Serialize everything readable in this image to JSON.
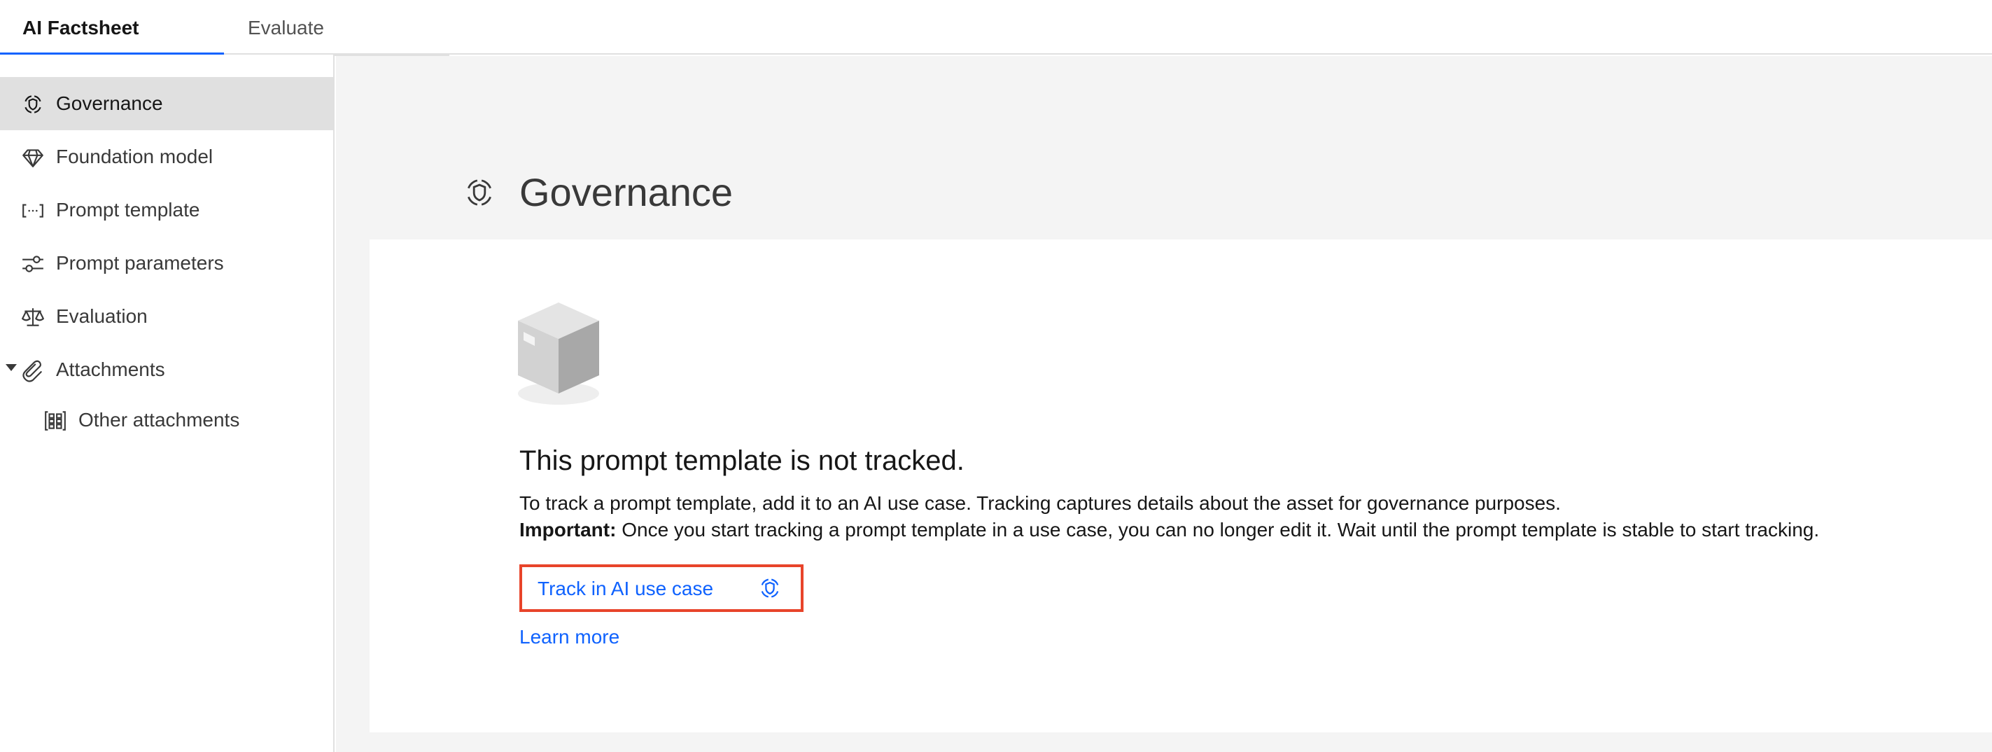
{
  "tabs": [
    {
      "label": "AI Factsheet",
      "selected": true
    },
    {
      "label": "Evaluate",
      "selected": false
    }
  ],
  "sidebar": {
    "items": [
      {
        "label": "Governance",
        "icon": "governance-icon",
        "selected": true
      },
      {
        "label": "Foundation model",
        "icon": "diamond-icon"
      },
      {
        "label": "Prompt template",
        "icon": "brackets-icon"
      },
      {
        "label": "Prompt parameters",
        "icon": "sliders-icon"
      },
      {
        "label": "Evaluation",
        "icon": "scale-icon"
      },
      {
        "label": "Attachments",
        "icon": "paperclip-icon",
        "expanded": true
      },
      {
        "label": "Other attachments",
        "icon": "grid-icon"
      }
    ]
  },
  "main": {
    "title": "Governance",
    "card": {
      "heading": "This prompt template is not tracked.",
      "description": "To track a prompt template, add it to an AI use case. Tracking captures details about the asset for governance purposes.",
      "important_label": "Important:",
      "important_text": " Once you start tracking a prompt template in a use case, you can no longer edit it. Wait until the prompt template is stable to start tracking.",
      "track_button": "Track in AI use case",
      "learn_more": "Learn more"
    }
  },
  "colors": {
    "accent": "#0f62fe",
    "highlight_border": "#e8442a",
    "selected_bg": "#e0e0e0",
    "main_bg": "#f4f4f4"
  }
}
